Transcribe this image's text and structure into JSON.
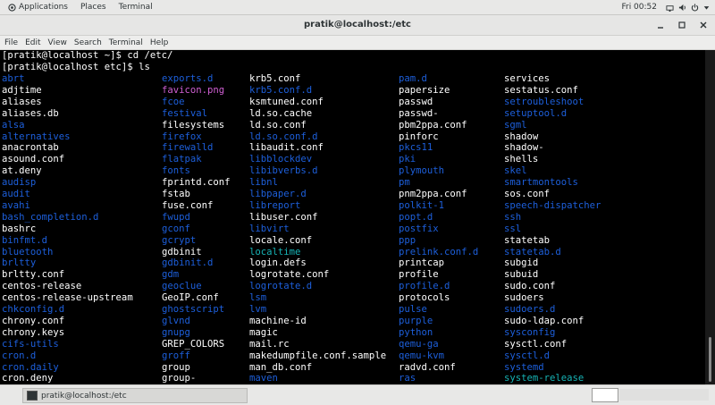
{
  "topbar": {
    "applications": "Applications",
    "places": "Places",
    "terminal": "Terminal",
    "clock": "Fri 00:52",
    "icons": [
      "network-icon",
      "volume-icon",
      "power-icon"
    ]
  },
  "window": {
    "title": "pratik@localhost:/etc",
    "controls": [
      "minimize",
      "maximize",
      "close"
    ]
  },
  "menubar": [
    "File",
    "Edit",
    "View",
    "Search",
    "Terminal",
    "Help"
  ],
  "terminal": {
    "lines": [
      "[pratik@localhost ~]$ cd /etc/",
      "[pratik@localhost etc]$ ls"
    ],
    "colors": {
      "plain": "#ffffff",
      "dir": "#1d5fdb",
      "link": "#16b3b5",
      "img": "#cf5fd2",
      "exec": "#2bb32b"
    },
    "columns": [
      [
        [
          "abrt",
          "dir"
        ],
        [
          "adjtime",
          "plain"
        ],
        [
          "aliases",
          "plain"
        ],
        [
          "aliases.db",
          "plain"
        ],
        [
          "alsa",
          "dir"
        ],
        [
          "alternatives",
          "dir"
        ],
        [
          "anacrontab",
          "plain"
        ],
        [
          "asound.conf",
          "plain"
        ],
        [
          "at.deny",
          "plain"
        ],
        [
          "audisp",
          "dir"
        ],
        [
          "audit",
          "dir"
        ],
        [
          "avahi",
          "dir"
        ],
        [
          "bash_completion.d",
          "dir"
        ],
        [
          "bashrc",
          "plain"
        ],
        [
          "binfmt.d",
          "dir"
        ],
        [
          "bluetooth",
          "dir"
        ],
        [
          "brltty",
          "dir"
        ],
        [
          "brltty.conf",
          "plain"
        ],
        [
          "centos-release",
          "plain"
        ],
        [
          "centos-release-upstream",
          "plain"
        ],
        [
          "chkconfig.d",
          "dir"
        ],
        [
          "chrony.conf",
          "plain"
        ],
        [
          "chrony.keys",
          "plain"
        ],
        [
          "cifs-utils",
          "dir"
        ],
        [
          "cron.d",
          "dir"
        ],
        [
          "cron.daily",
          "dir"
        ],
        [
          "cron.deny",
          "plain"
        ]
      ],
      [
        [
          "exports.d",
          "dir"
        ],
        [
          "favicon.png",
          "img"
        ],
        [
          "fcoe",
          "dir"
        ],
        [
          "festival",
          "dir"
        ],
        [
          "filesystems",
          "plain"
        ],
        [
          "firefox",
          "dir"
        ],
        [
          "firewalld",
          "dir"
        ],
        [
          "flatpak",
          "dir"
        ],
        [
          "fonts",
          "dir"
        ],
        [
          "fprintd.conf",
          "plain"
        ],
        [
          "fstab",
          "plain"
        ],
        [
          "fuse.conf",
          "plain"
        ],
        [
          "fwupd",
          "dir"
        ],
        [
          "gconf",
          "dir"
        ],
        [
          "gcrypt",
          "dir"
        ],
        [
          "gdbinit",
          "plain"
        ],
        [
          "gdbinit.d",
          "dir"
        ],
        [
          "gdm",
          "dir"
        ],
        [
          "geoclue",
          "dir"
        ],
        [
          "GeoIP.conf",
          "plain"
        ],
        [
          "ghostscript",
          "dir"
        ],
        [
          "glvnd",
          "dir"
        ],
        [
          "gnupg",
          "dir"
        ],
        [
          "GREP_COLORS",
          "plain"
        ],
        [
          "groff",
          "dir"
        ],
        [
          "group",
          "plain"
        ],
        [
          "group-",
          "plain"
        ]
      ],
      [
        [
          "krb5.conf",
          "plain"
        ],
        [
          "krb5.conf.d",
          "dir"
        ],
        [
          "ksmtuned.conf",
          "plain"
        ],
        [
          "ld.so.cache",
          "plain"
        ],
        [
          "ld.so.conf",
          "plain"
        ],
        [
          "ld.so.conf.d",
          "dir"
        ],
        [
          "libaudit.conf",
          "plain"
        ],
        [
          "libblockdev",
          "dir"
        ],
        [
          "libibverbs.d",
          "dir"
        ],
        [
          "libnl",
          "dir"
        ],
        [
          "libpaper.d",
          "dir"
        ],
        [
          "libreport",
          "dir"
        ],
        [
          "libuser.conf",
          "plain"
        ],
        [
          "libvirt",
          "dir"
        ],
        [
          "locale.conf",
          "plain"
        ],
        [
          "localtime",
          "link"
        ],
        [
          "login.defs",
          "plain"
        ],
        [
          "logrotate.conf",
          "plain"
        ],
        [
          "logrotate.d",
          "dir"
        ],
        [
          "lsm",
          "dir"
        ],
        [
          "lvm",
          "dir"
        ],
        [
          "machine-id",
          "plain"
        ],
        [
          "magic",
          "plain"
        ],
        [
          "mail.rc",
          "plain"
        ],
        [
          "makedumpfile.conf.sample",
          "plain"
        ],
        [
          "man_db.conf",
          "plain"
        ],
        [
          "maven",
          "dir"
        ]
      ],
      [
        [
          "pam.d",
          "dir"
        ],
        [
          "papersize",
          "plain"
        ],
        [
          "passwd",
          "plain"
        ],
        [
          "passwd-",
          "plain"
        ],
        [
          "pbm2ppa.conf",
          "plain"
        ],
        [
          "pinforc",
          "plain"
        ],
        [
          "pkcs11",
          "dir"
        ],
        [
          "pki",
          "dir"
        ],
        [
          "plymouth",
          "dir"
        ],
        [
          "pm",
          "dir"
        ],
        [
          "pnm2ppa.conf",
          "plain"
        ],
        [
          "polkit-1",
          "dir"
        ],
        [
          "popt.d",
          "dir"
        ],
        [
          "postfix",
          "dir"
        ],
        [
          "ppp",
          "dir"
        ],
        [
          "prelink.conf.d",
          "dir"
        ],
        [
          "printcap",
          "plain"
        ],
        [
          "profile",
          "plain"
        ],
        [
          "profile.d",
          "dir"
        ],
        [
          "protocols",
          "plain"
        ],
        [
          "pulse",
          "dir"
        ],
        [
          "purple",
          "dir"
        ],
        [
          "python",
          "dir"
        ],
        [
          "qemu-ga",
          "dir"
        ],
        [
          "qemu-kvm",
          "dir"
        ],
        [
          "radvd.conf",
          "plain"
        ],
        [
          "ras",
          "dir"
        ]
      ],
      [
        [
          "services",
          "plain"
        ],
        [
          "sestatus.conf",
          "plain"
        ],
        [
          "setroubleshoot",
          "dir"
        ],
        [
          "setuptool.d",
          "dir"
        ],
        [
          "sgml",
          "dir"
        ],
        [
          "shadow",
          "plain"
        ],
        [
          "shadow-",
          "plain"
        ],
        [
          "shells",
          "plain"
        ],
        [
          "skel",
          "dir"
        ],
        [
          "smartmontools",
          "dir"
        ],
        [
          "sos.conf",
          "plain"
        ],
        [
          "speech-dispatcher",
          "dir"
        ],
        [
          "ssh",
          "dir"
        ],
        [
          "ssl",
          "dir"
        ],
        [
          "statetab",
          "plain"
        ],
        [
          "statetab.d",
          "dir"
        ],
        [
          "subgid",
          "plain"
        ],
        [
          "subuid",
          "plain"
        ],
        [
          "sudo.conf",
          "plain"
        ],
        [
          "sudoers",
          "plain"
        ],
        [
          "sudoers.d",
          "dir"
        ],
        [
          "sudo-ldap.conf",
          "plain"
        ],
        [
          "sysconfig",
          "dir"
        ],
        [
          "sysctl.conf",
          "plain"
        ],
        [
          "sysctl.d",
          "dir"
        ],
        [
          "systemd",
          "dir"
        ],
        [
          "system-release",
          "link"
        ]
      ]
    ]
  },
  "taskbar": {
    "task_label": "pratik@localhost:/etc"
  }
}
